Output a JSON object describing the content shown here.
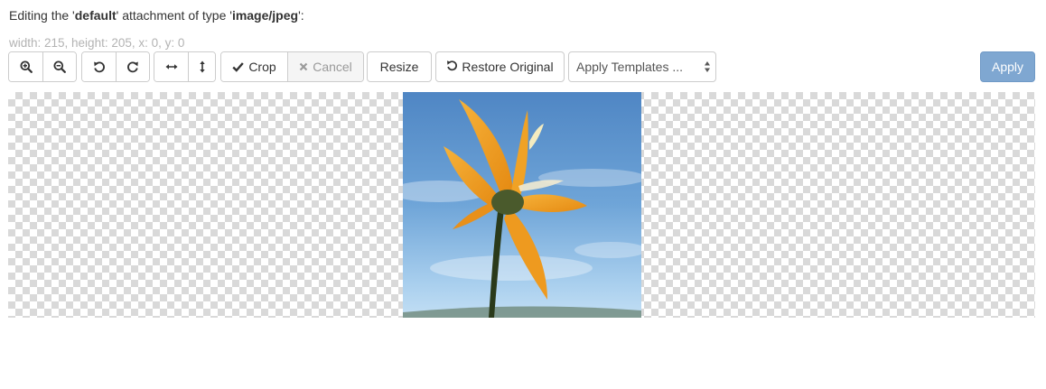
{
  "heading": {
    "prefix": "Editing the '",
    "attachment": "default",
    "middle": "' attachment of type '",
    "type": "image/jpeg",
    "suffix": "':"
  },
  "dimensions_text": "width: 215, height: 205, x: 0, y: 0",
  "toolbar": {
    "crop_label": "Crop",
    "cancel_label": "Cancel",
    "resize_label": "Resize",
    "restore_label": "Restore Original",
    "templates_value": "Apply Templates ...",
    "apply_label": "Apply"
  },
  "icons": {
    "zoom_in": "zoom-in-icon",
    "zoom_out": "zoom-out-icon",
    "rotate_left": "rotate-left-icon",
    "rotate_right": "rotate-right-icon",
    "flip_horizontal": "flip-horizontal-icon",
    "flip_vertical": "flip-vertical-icon",
    "check": "check-icon",
    "cancel": "x-icon",
    "restore": "undo-icon",
    "select_arrows": "updown-arrows-icon"
  },
  "colors": {
    "apply_button": "#7fa7d1",
    "dimensions_text": "#b3b3b3",
    "checker": "#d9d9d9"
  }
}
